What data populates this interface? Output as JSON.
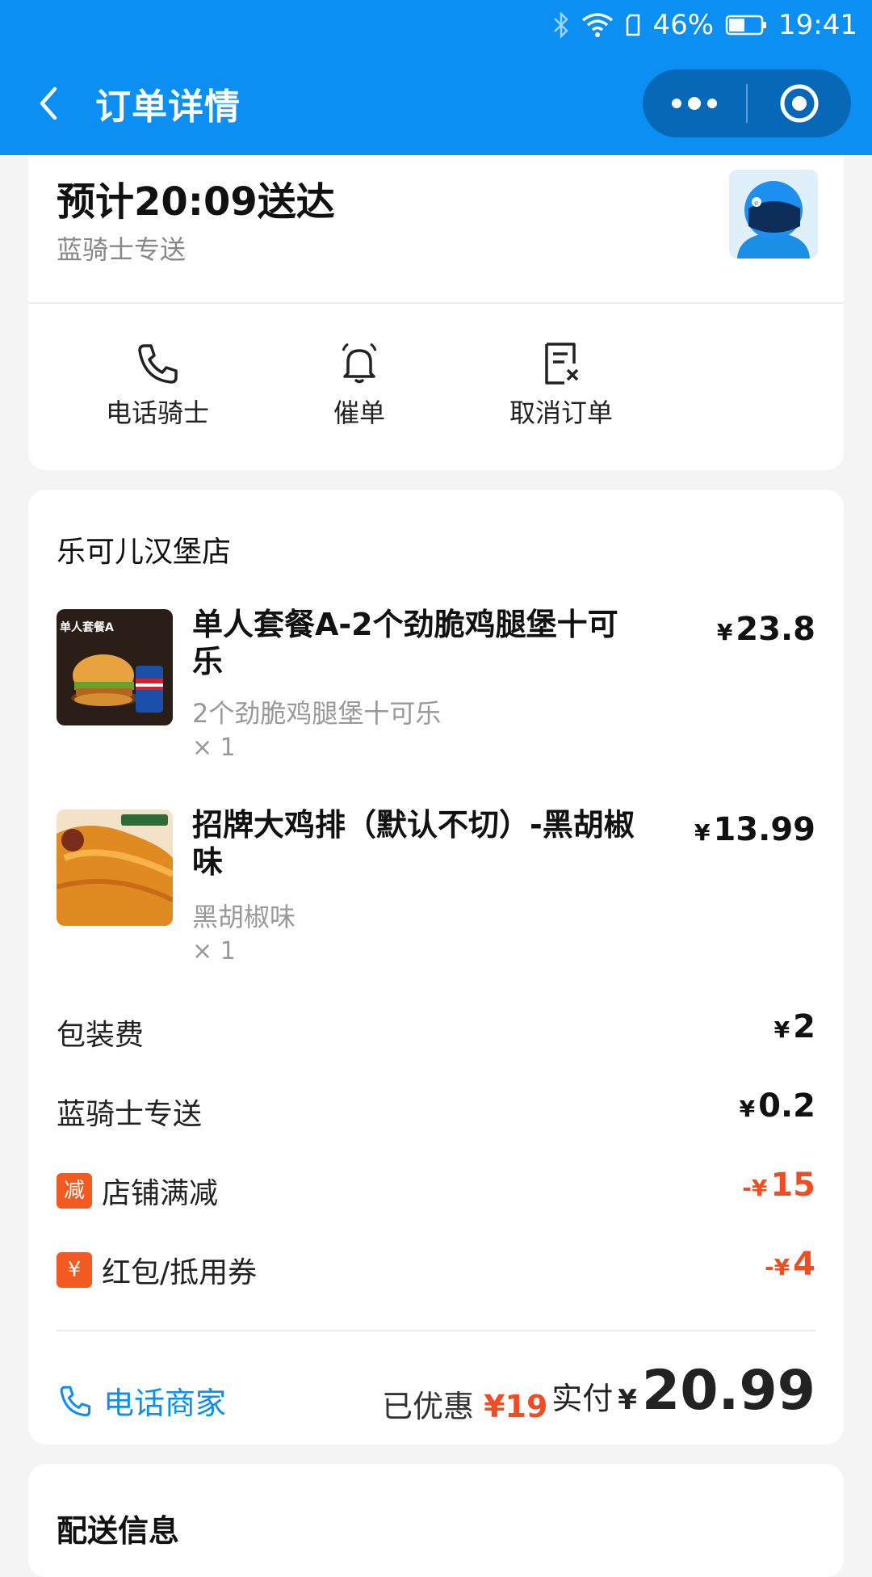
{
  "status_bar": {
    "battery": "46%",
    "time": "19:41"
  },
  "nav": {
    "title": "订单详情"
  },
  "delivery_summary": {
    "eta": "预计20:09送达",
    "rider_type": "蓝骑士专送"
  },
  "actions": [
    {
      "label": "电话骑士",
      "icon": "phone-icon"
    },
    {
      "label": "催单",
      "icon": "bell-icon"
    },
    {
      "label": "取消订单",
      "icon": "cancel-order-icon"
    }
  ],
  "order": {
    "shop_name": "乐可儿汉堡店",
    "items": [
      {
        "name": "单人套餐A-2个劲脆鸡腿堡十可乐",
        "desc": "2个劲脆鸡腿堡十可乐",
        "qty": "× 1",
        "currency": "¥",
        "price": "23.8",
        "thumb_caption": "单人套餐A"
      },
      {
        "name": "招牌大鸡排（默认不切）-黑胡椒味",
        "desc": "黑胡椒味",
        "qty": "× 1",
        "currency": "¥",
        "price": "13.99",
        "thumb_caption": ""
      }
    ],
    "fees": [
      {
        "label": "包装费",
        "value": "2",
        "prefix": "¥",
        "tag": ""
      },
      {
        "label": "蓝骑士专送",
        "value": "0.2",
        "prefix": "¥",
        "tag": ""
      },
      {
        "label": "店铺满减",
        "value": "15",
        "prefix": "-¥",
        "tag": "减"
      },
      {
        "label": "红包/抵用券",
        "value": "4",
        "prefix": "-¥",
        "tag": "¥"
      }
    ],
    "call_shop_label": "电话商家",
    "discount_label": "已优惠",
    "discount_amount": "¥19",
    "paid_label": "实付",
    "paid_currency": "¥",
    "paid_amount": "20.99"
  },
  "delivery_info": {
    "title": "配送信息"
  },
  "colors": {
    "brand_blue": "#0b8ff2",
    "accent_red": "#f04d23"
  }
}
